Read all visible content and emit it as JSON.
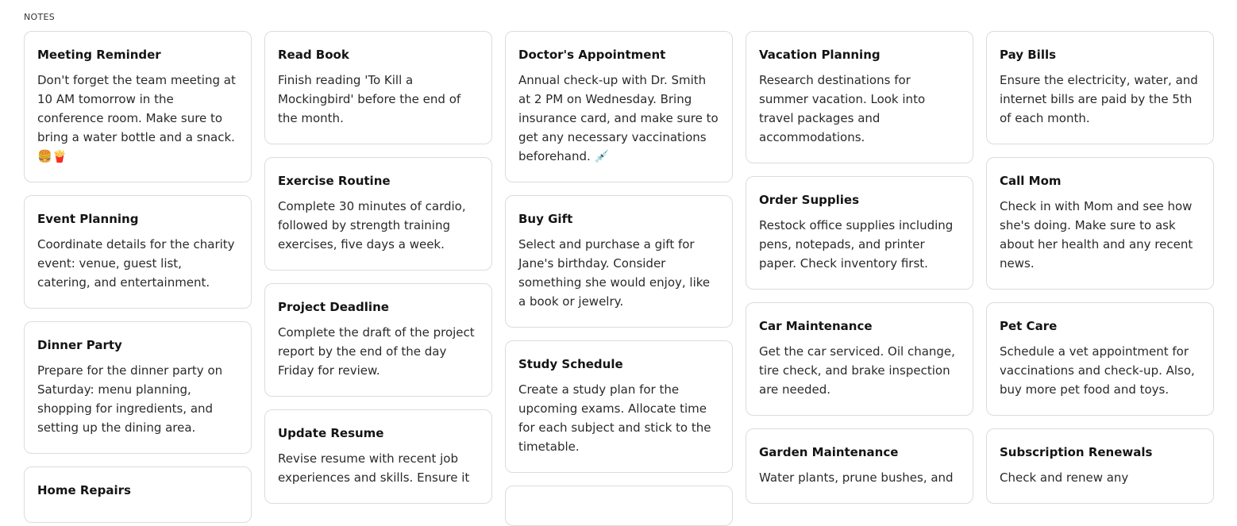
{
  "section_label": "NOTES",
  "columns": [
    [
      {
        "title": "Meeting Reminder",
        "body": "Don't forget the team meeting at 10 AM tomorrow in the conference room. Make sure to bring a water bottle and a snack. 🍔🍟"
      },
      {
        "title": "Event Planning",
        "body": "Coordinate details for the charity event: venue, guest list, catering, and entertainment."
      },
      {
        "title": "Dinner Party",
        "body": "Prepare for the dinner party on Saturday: menu planning, shopping for ingredients, and setting up the dining area."
      },
      {
        "title": "Home Repairs",
        "body": ""
      }
    ],
    [
      {
        "title": "Read Book",
        "body": "Finish reading 'To Kill a Mockingbird' before the end of the month."
      },
      {
        "title": "Exercise Routine",
        "body": "Complete 30 minutes of cardio, followed by strength training exercises, five days a week."
      },
      {
        "title": "Project Deadline",
        "body": "Complete the draft of the project report by the end of the day Friday for review."
      },
      {
        "title": "Update Resume",
        "body": "Revise resume with recent job experiences and skills. Ensure it"
      }
    ],
    [
      {
        "title": "Doctor's Appointment",
        "body": "Annual check-up with Dr. Smith at 2 PM on Wednesday. Bring insurance card, and make sure to get any necessary vaccinations beforehand. 💉"
      },
      {
        "title": "Buy Gift",
        "body": "Select and purchase a gift for Jane's birthday. Consider something she would enjoy, like a book or jewelry."
      },
      {
        "title": "Study Schedule",
        "body": "Create a study plan for the upcoming exams. Allocate time for each subject and stick to the timetable."
      },
      {
        "title": "",
        "body": ""
      }
    ],
    [
      {
        "title": "Vacation Planning",
        "body": "Research destinations for summer vacation. Look into travel packages and accommodations."
      },
      {
        "title": "Order Supplies",
        "body": "Restock office supplies including pens, notepads, and printer paper. Check inventory first."
      },
      {
        "title": "Car Maintenance",
        "body": "Get the car serviced. Oil change, tire check, and brake inspection are needed."
      },
      {
        "title": "Garden Maintenance",
        "body": "Water plants, prune bushes, and"
      }
    ],
    [
      {
        "title": "Pay Bills",
        "body": "Ensure the electricity, water, and internet bills are paid by the 5th of each month."
      },
      {
        "title": "Call Mom",
        "body": "Check in with Mom and see how she's doing. Make sure to ask about her health and any recent news."
      },
      {
        "title": "Pet Care",
        "body": "Schedule a vet appointment for vaccinations and check-up. Also, buy more pet food and toys."
      },
      {
        "title": "Subscription Renewals",
        "body": "Check and renew any"
      }
    ]
  ]
}
